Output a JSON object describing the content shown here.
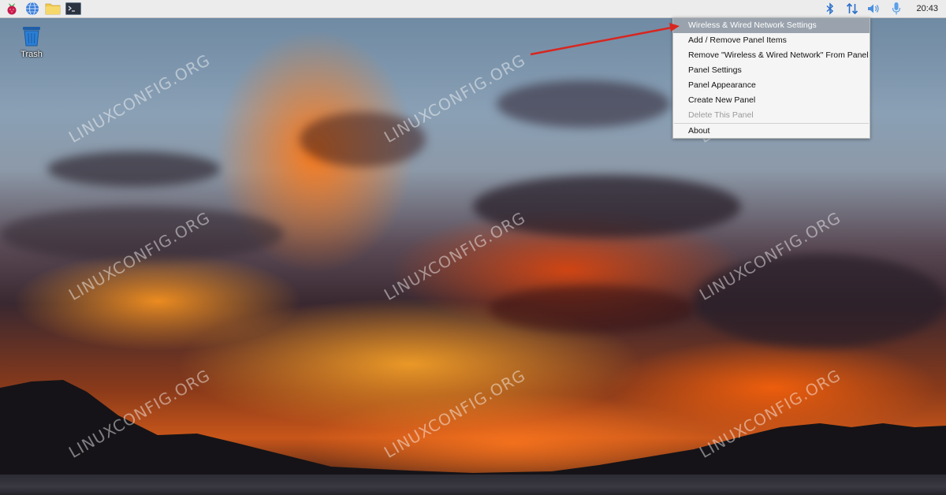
{
  "taskbar": {
    "launchers": [
      {
        "name": "raspberry-menu-icon"
      },
      {
        "name": "web-browser-icon"
      },
      {
        "name": "file-manager-icon"
      },
      {
        "name": "terminal-icon"
      }
    ],
    "tray": {
      "icons": [
        "bluetooth-icon",
        "network-icon",
        "volume-icon",
        "microphone-icon"
      ],
      "clock": "20:43"
    }
  },
  "desktop": {
    "icons": [
      {
        "label": "Trash",
        "icon": "trash-icon"
      }
    ],
    "watermark": "LINUXCONFIG.ORG"
  },
  "context_menu": {
    "items": [
      {
        "label": "Wireless & Wired Network Settings",
        "state": "highlighted"
      },
      {
        "label": "Add / Remove Panel Items",
        "state": "normal"
      },
      {
        "label": "Remove \"Wireless & Wired Network\" From Panel",
        "state": "normal"
      },
      {
        "label": "Panel Settings",
        "state": "normal"
      },
      {
        "label": "Panel Appearance",
        "state": "normal"
      },
      {
        "label": "Create New Panel",
        "state": "normal"
      },
      {
        "label": "Delete This Panel",
        "state": "disabled"
      },
      {
        "label": "About",
        "state": "normal"
      }
    ]
  },
  "colors": {
    "panel_bg": "#ececec",
    "menu_highlight": "#9aa3ad",
    "annotation_arrow": "#d8261f"
  }
}
